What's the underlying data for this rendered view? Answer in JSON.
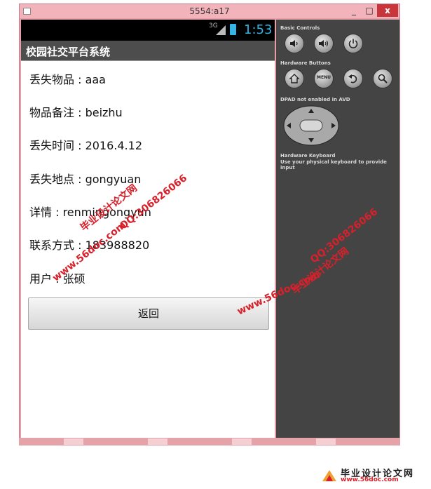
{
  "window": {
    "title": "5554:a17",
    "min_label": "_",
    "max_label": "□",
    "close_label": "x"
  },
  "status_bar": {
    "network_label": "3G",
    "time": "1:53"
  },
  "app": {
    "title": "校园社交平台系统"
  },
  "fields": [
    {
      "text": "丢失物品 : aaa"
    },
    {
      "text": "物品备注 : beizhu"
    },
    {
      "text": "丢失时间 : 2016.4.12"
    },
    {
      "text": "丢失地点 : gongyuan"
    },
    {
      "text": "详情 : renmingongyun"
    },
    {
      "text": "联系方式 : 183988820"
    },
    {
      "text": "用户 : 张硕"
    }
  ],
  "back_button": {
    "label": "返回"
  },
  "controls": {
    "basic_label": "Basic Controls",
    "hardware_label": "Hardware Buttons",
    "menu_label": "MENU",
    "dpad_label": "DPAD not enabled in AVD",
    "keyboard_label": "Hardware Keyboard",
    "keyboard_hint": "Use your physical keyboard to provide input",
    "icons": [
      "volume-down-icon",
      "volume-up-icon",
      "power-icon",
      "home-icon",
      "menu-icon",
      "back-icon",
      "search-icon"
    ]
  },
  "watermarks": {
    "site": "www.56doc.com",
    "qq": "QQ:306826066",
    "name": "毕业设计论文网"
  },
  "footer": {
    "name": "毕业设计论文网",
    "url": "www.56doc.com"
  },
  "colors": {
    "accent": "#33b5e5",
    "window_frame": "#e8a0a8",
    "close_button": "#c7363b",
    "watermark": "#d9202a"
  }
}
